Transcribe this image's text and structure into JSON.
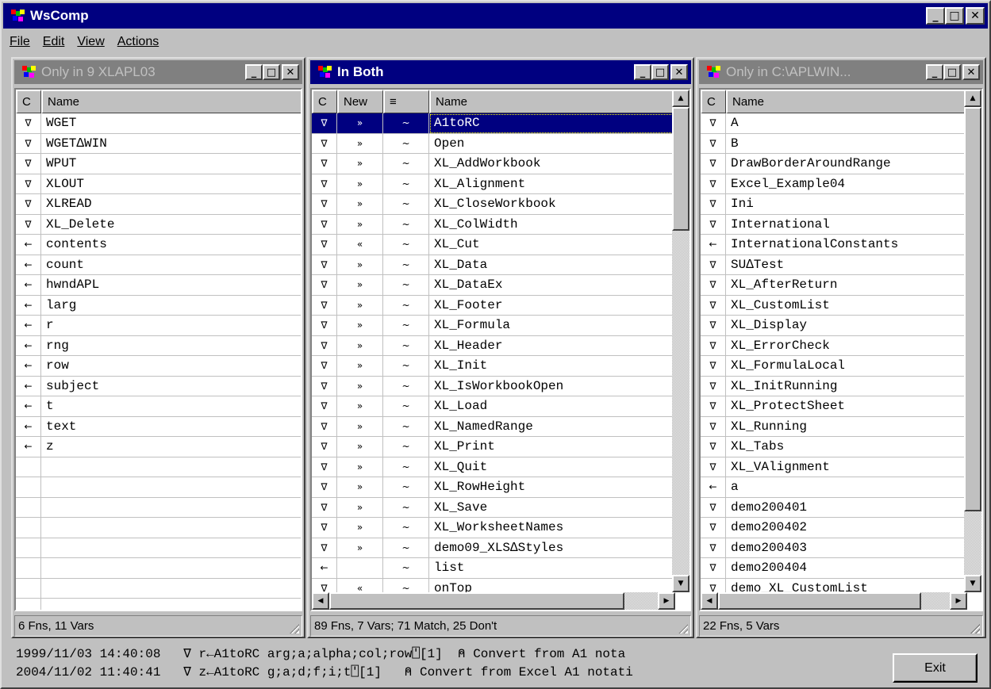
{
  "window": {
    "title": "WsComp"
  },
  "menu": [
    "File",
    "Edit",
    "View",
    "Actions"
  ],
  "left_pane": {
    "title": "Only in 9 XLAPL03",
    "columns": [
      "C",
      "Name"
    ],
    "rows": [
      [
        "∇",
        "WGET"
      ],
      [
        "∇",
        "WGET∆WIN"
      ],
      [
        "∇",
        "WPUT"
      ],
      [
        "∇",
        "XLOUT"
      ],
      [
        "∇",
        "XLREAD"
      ],
      [
        "∇",
        "XL_Delete"
      ],
      [
        "←",
        "contents"
      ],
      [
        "←",
        "count"
      ],
      [
        "←",
        "hwndAPL"
      ],
      [
        "←",
        "larg"
      ],
      [
        "←",
        "r"
      ],
      [
        "←",
        "rng"
      ],
      [
        "←",
        "row"
      ],
      [
        "←",
        "subject"
      ],
      [
        "←",
        "t"
      ],
      [
        "←",
        "text"
      ],
      [
        "←",
        "z"
      ]
    ],
    "status": "6 Fns, 11 Vars"
  },
  "center_pane": {
    "title": "In Both",
    "columns": [
      "C",
      "New",
      "≡",
      "Name"
    ],
    "rows": [
      [
        "∇",
        "»",
        "~",
        "A1toRC"
      ],
      [
        "∇",
        "»",
        "~",
        "Open"
      ],
      [
        "∇",
        "»",
        "~",
        "XL_AddWorkbook"
      ],
      [
        "∇",
        "»",
        "~",
        "XL_Alignment"
      ],
      [
        "∇",
        "»",
        "~",
        "XL_CloseWorkbook"
      ],
      [
        "∇",
        "»",
        "~",
        "XL_ColWidth"
      ],
      [
        "∇",
        "«",
        "~",
        "XL_Cut"
      ],
      [
        "∇",
        "»",
        "~",
        "XL_Data"
      ],
      [
        "∇",
        "»",
        "~",
        "XL_DataEx"
      ],
      [
        "∇",
        "»",
        "~",
        "XL_Footer"
      ],
      [
        "∇",
        "»",
        "~",
        "XL_Formula"
      ],
      [
        "∇",
        "»",
        "~",
        "XL_Header"
      ],
      [
        "∇",
        "»",
        "~",
        "XL_Init"
      ],
      [
        "∇",
        "»",
        "~",
        "XL_IsWorkbookOpen"
      ],
      [
        "∇",
        "»",
        "~",
        "XL_Load"
      ],
      [
        "∇",
        "»",
        "~",
        "XL_NamedRange"
      ],
      [
        "∇",
        "»",
        "~",
        "XL_Print"
      ],
      [
        "∇",
        "»",
        "~",
        "XL_Quit"
      ],
      [
        "∇",
        "»",
        "~",
        "XL_RowHeight"
      ],
      [
        "∇",
        "»",
        "~",
        "XL_Save"
      ],
      [
        "∇",
        "»",
        "~",
        "XL_WorksheetNames"
      ],
      [
        "∇",
        "»",
        "~",
        "demo09_XLS∆Styles"
      ],
      [
        "←",
        "",
        "~",
        "list"
      ],
      [
        "∇",
        "«",
        "~",
        "onTop"
      ]
    ],
    "selected_row": 0,
    "status": "89 Fns, 7 Vars; 71 Match, 25 Don't"
  },
  "right_pane": {
    "title": "Only in C:\\APLWIN...",
    "columns": [
      "C",
      "Name"
    ],
    "rows": [
      [
        "∇",
        "A"
      ],
      [
        "∇",
        "B"
      ],
      [
        "∇",
        "DrawBorderAroundRange"
      ],
      [
        "∇",
        "Excel_Example04"
      ],
      [
        "∇",
        "Ini"
      ],
      [
        "∇",
        "International"
      ],
      [
        "←",
        "InternationalConstants"
      ],
      [
        "∇",
        "SU∆Test"
      ],
      [
        "∇",
        "XL_AfterReturn"
      ],
      [
        "∇",
        "XL_CustomList"
      ],
      [
        "∇",
        "XL_Display"
      ],
      [
        "∇",
        "XL_ErrorCheck"
      ],
      [
        "∇",
        "XL_FormulaLocal"
      ],
      [
        "∇",
        "XL_InitRunning"
      ],
      [
        "∇",
        "XL_ProtectSheet"
      ],
      [
        "∇",
        "XL_Running"
      ],
      [
        "∇",
        "XL_Tabs"
      ],
      [
        "∇",
        "XL_VAlignment"
      ],
      [
        "←",
        "a"
      ],
      [
        "∇",
        "demo200401"
      ],
      [
        "∇",
        "demo200402"
      ],
      [
        "∇",
        "demo200403"
      ],
      [
        "∇",
        "demo200404"
      ],
      [
        "∇",
        "demo_XL_CustomList"
      ]
    ],
    "status": "22 Fns, 5 Vars"
  },
  "info": {
    "line1": "1999/11/03 14:40:08   ∇ r←A1toRC arg;a;alpha;col;row⍞[1]  ⍝ Convert from A1 nota",
    "line2": "2004/11/02 11:40:41   ∇ z←A1toRC g;a;d;f;i;t⍞[1]   ⍝ Convert from Excel A1 notati"
  },
  "buttons": {
    "exit": "Exit"
  },
  "colors": {
    "active_title": "#000080",
    "inactive_title": "#808080",
    "face": "#c0c0c0",
    "selection": "#000080"
  }
}
